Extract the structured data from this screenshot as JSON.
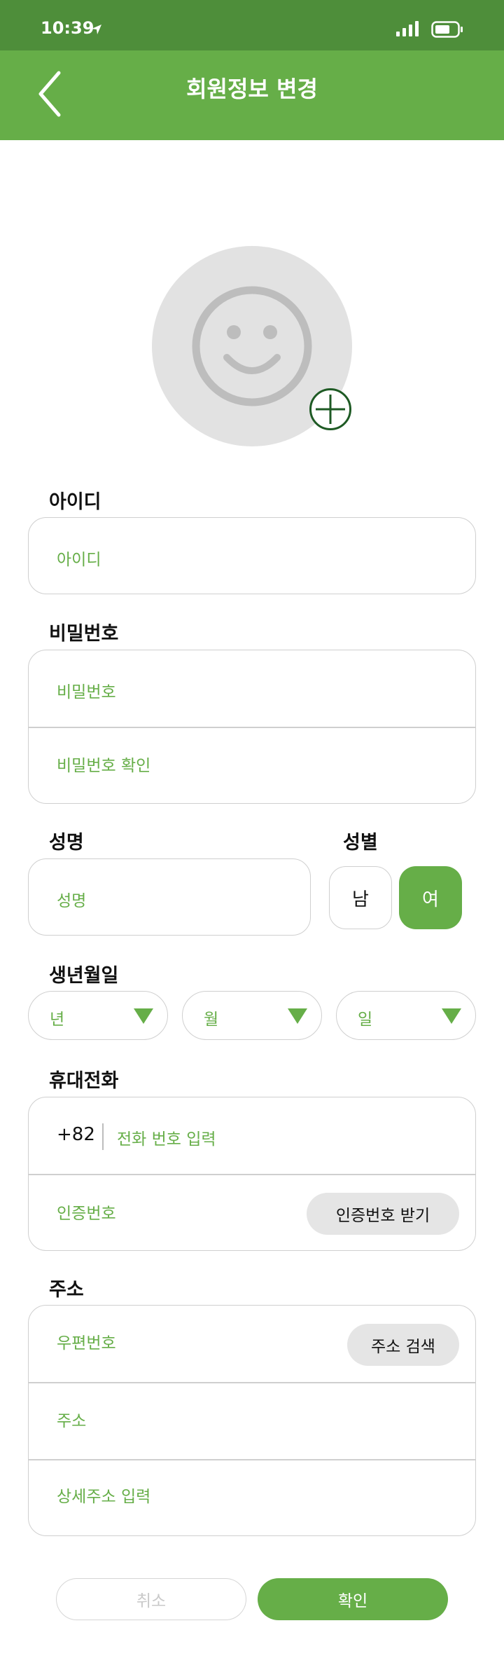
{
  "status_bar": {
    "time": "10:39"
  },
  "header": {
    "title": "회원정보 변경"
  },
  "form": {
    "id": {
      "label": "아이디",
      "placeholder": "아이디"
    },
    "password": {
      "label": "비밀번호",
      "placeholder": "비밀번호",
      "confirm_placeholder": "비밀번호 확인"
    },
    "name": {
      "label": "성명",
      "placeholder": "성명"
    },
    "gender": {
      "label": "성별",
      "male": "남",
      "female": "여",
      "selected": "여"
    },
    "birth": {
      "label": "생년월일",
      "year": "년",
      "month": "월",
      "day": "일"
    },
    "phone": {
      "label": "휴대전화",
      "country_code": "+82",
      "placeholder": "전화 번호 입력",
      "code_placeholder": "인증번호",
      "request_code_button": "인증번호 받기"
    },
    "address": {
      "label": "주소",
      "postcode_placeholder": "우편번호",
      "search_button": "주소 검색",
      "address_placeholder": "주소",
      "detail_placeholder": "상세주소 입력"
    }
  },
  "actions": {
    "cancel": "취소",
    "confirm": "확인"
  },
  "colors": {
    "status_bar": "#4e8e3a",
    "accent": "#66ae48",
    "border": "#cfcfcf",
    "avatar_bg": "#e2e2e2",
    "add_icon": "#1e5a24"
  }
}
